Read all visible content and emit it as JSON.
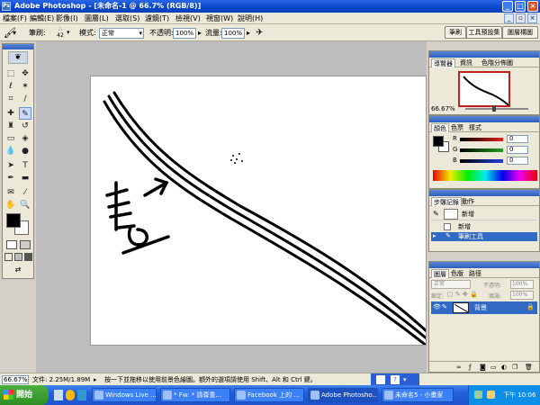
{
  "window": {
    "title": "Adobe Photoshop - [未命名-1 @ 66.7% (RGB/8)]",
    "min": "_",
    "max": "□",
    "close": "×"
  },
  "menu": [
    "檔案(F)",
    "編輯(E)",
    "影像(I)",
    "圖層(L)",
    "選取(S)",
    "濾鏡(T)",
    "檢視(V)",
    "視窗(W)",
    "說明(H)"
  ],
  "options": {
    "brush_label": "筆刷:",
    "brush_size": "42",
    "mode_label": "模式:",
    "mode_value": "正常",
    "opacity_label": "不透明:",
    "opacity_value": "100%",
    "flow_label": "流量:",
    "flow_value": "100%",
    "tabs": [
      "筆刷",
      "工具預設集",
      "圖層構圖"
    ]
  },
  "navigator": {
    "tabs": [
      "導覽器",
      "資訊",
      "色階分佈圖"
    ],
    "zoom": "66.67%"
  },
  "color": {
    "tabs": [
      "顏色",
      "色票",
      "樣式"
    ],
    "channels": [
      {
        "label": "R",
        "value": "0",
        "color": "#e02020"
      },
      {
        "label": "G",
        "value": "0",
        "color": "#20a020"
      },
      {
        "label": "B",
        "value": "0",
        "color": "#2040e0"
      }
    ]
  },
  "history": {
    "tabs": [
      "步驟記錄",
      "動作"
    ],
    "snapshot": "新增",
    "steps": [
      {
        "label": "新增",
        "active": false
      },
      {
        "label": "筆刷工具",
        "active": true
      }
    ]
  },
  "layers": {
    "tabs": [
      "圖層",
      "色版",
      "路徑"
    ],
    "blend_mode": "正常",
    "opacity_label": "不透明:",
    "opacity_value": "100%",
    "lock_label": "鎖定:",
    "fill_label": "填滿:",
    "fill_value": "100%",
    "items": [
      {
        "name": "背景"
      }
    ]
  },
  "status": {
    "zoom": "66.67%",
    "doc_info": "文件: 2.25M/1.89M",
    "hint": "按一下並拖移以使用前景色繪圖。額外的選項請使用 Shift、Alt 和 Ctrl 鍵。"
  },
  "taskbar": {
    "start": "開始",
    "tasks": [
      {
        "label": "Windows Live ...",
        "active": false
      },
      {
        "label": "* Fw: * 請尊重...",
        "active": false
      },
      {
        "label": "Facebook 上的 ...",
        "active": false
      },
      {
        "label": "Adobe Photosho...",
        "active": true
      },
      {
        "label": "未命名5 - 小畫家",
        "active": false
      }
    ],
    "clock": "下午 10:06"
  },
  "accent": "#0a46c8"
}
